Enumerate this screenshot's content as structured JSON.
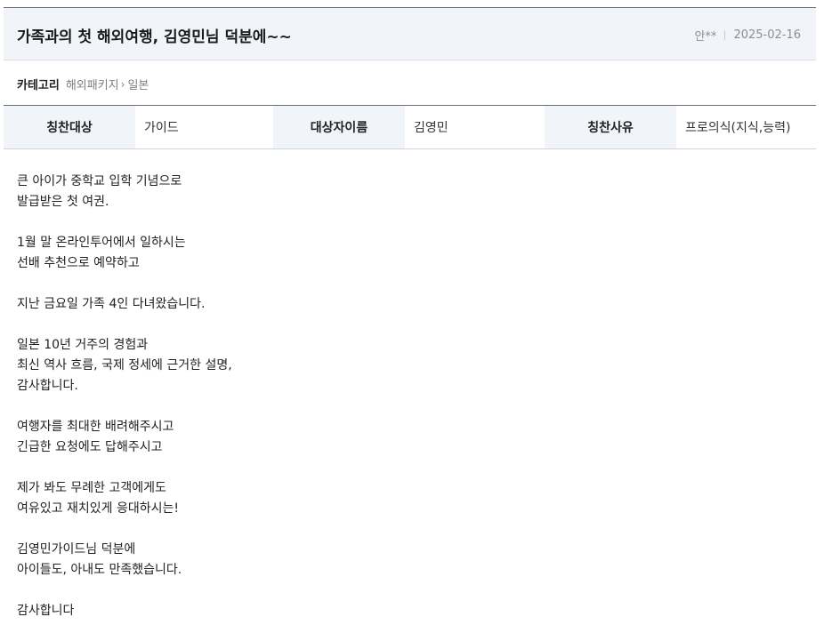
{
  "post": {
    "title": "가족과의 첫 해외여행, 김영민님 덕분에~~",
    "author": "안**",
    "date": "2025-02-16"
  },
  "category": {
    "label": "카테고리",
    "path_parent": "해외패키지",
    "path_child": "일본"
  },
  "info": {
    "target_label": "칭찬대상",
    "target_value": "가이드",
    "name_label": "대상자이름",
    "name_value": "김영민",
    "reason_label": "칭찬사유",
    "reason_value": "프로의식(지식,능력)"
  },
  "body": {
    "paragraphs": [
      [
        "큰 아이가 중학교 입학 기념으로",
        "발급받은 첫 여권."
      ],
      [
        "1월 말 온라인투어에서 일하시는",
        "선배 추천으로 예약하고"
      ],
      [
        "지난 금요일 가족 4인 다녀왔습니다."
      ],
      [
        "일본 10년 거주의 경험과",
        "최신 역사 흐름, 국제 정세에 근거한 설명,",
        "감사합니다."
      ],
      [
        "여행자를 최대한 배려해주시고",
        "긴급한 요청에도 답해주시고"
      ],
      [
        "제가 봐도 무례한 고객에게도",
        "여유있고 재치있게 응대하시는!"
      ],
      [
        "김영민가이드님 덕분에",
        "아이들도, 아내도 만족했습니다."
      ],
      [
        "감사합니다"
      ]
    ]
  }
}
